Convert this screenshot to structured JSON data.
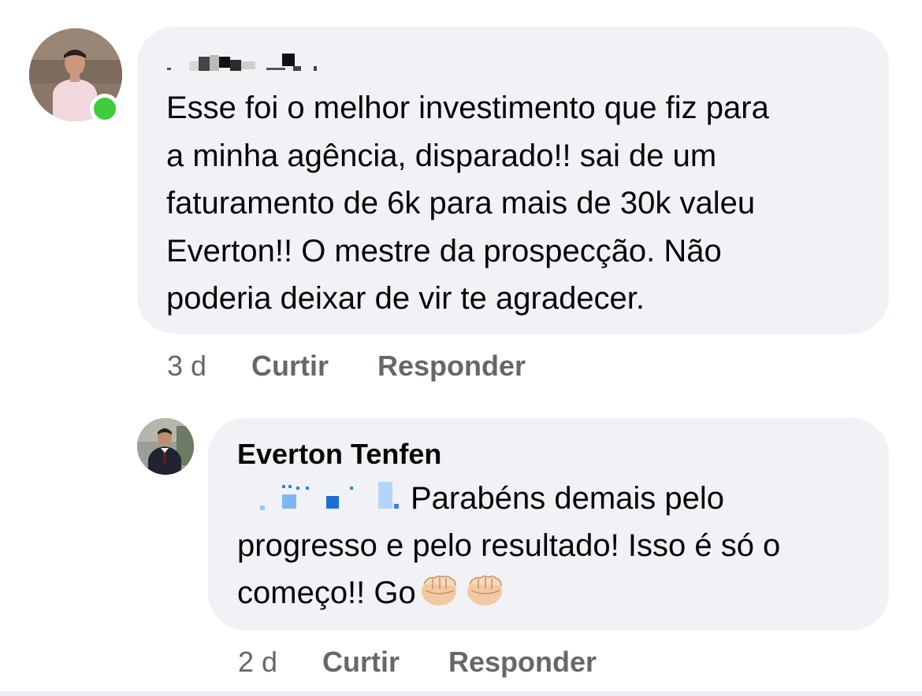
{
  "comment": {
    "author_redacted": true,
    "text": "Esse foi o melhor investimento que fiz para\na minha agência, disparado!! sai de um\nfaturamento de 6k para mais de 30k valeu\nEverton!! O mestre da prospecção. Não\npoderia deixar de vir te agradecer.",
    "time": "3 d",
    "like_label": "Curtir",
    "reply_label": "Responder",
    "online": true
  },
  "reply": {
    "author": "Everton Tenfen",
    "mention_redacted": true,
    "line1": "Parabéns demais pelo",
    "line2": "progresso e pelo resultado! Isso é só o",
    "line3": "começo!! Go",
    "emojis": [
      "fist-bump-icon",
      "fist-bump-icon"
    ],
    "time": "2 d",
    "like_label": "Curtir",
    "reply_label": "Responder"
  },
  "colors": {
    "bubble_bg": "#f0f2f5",
    "text": "#050505",
    "secondary": "#65676b",
    "online": "#3fcb3c",
    "mention": "#1877f2"
  }
}
